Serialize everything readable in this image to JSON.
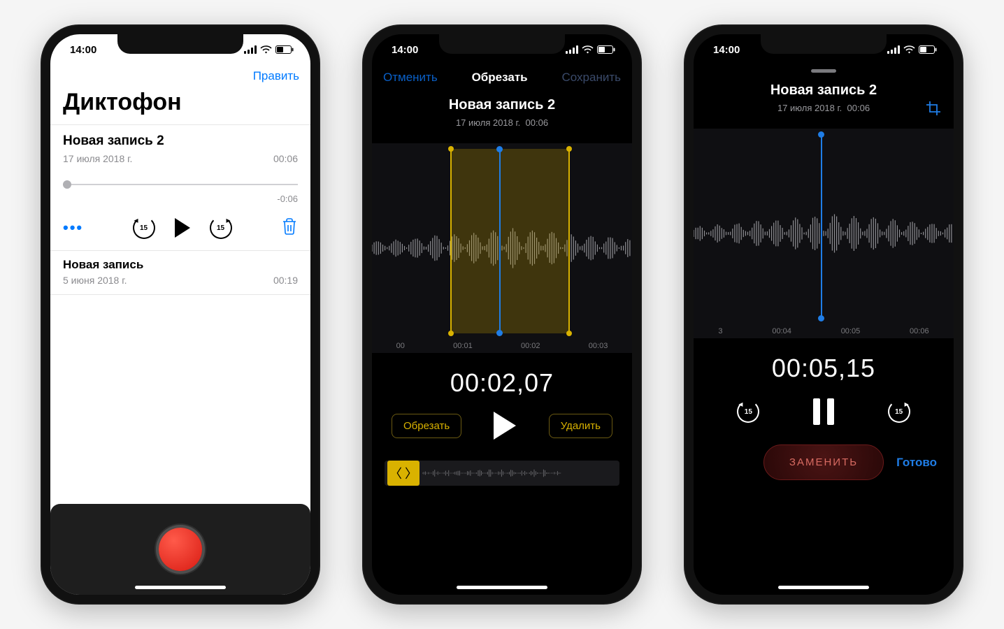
{
  "status": {
    "time": "14:00"
  },
  "screen1": {
    "edit": "Править",
    "appTitle": "Диктофон",
    "expanded": {
      "title": "Новая запись 2",
      "date": "17 июля 2018 г.",
      "duration": "00:06",
      "remaining": "-0:06"
    },
    "secondRow": {
      "title": "Новая запись",
      "date": "5 июня 2018 г.",
      "duration": "00:19"
    },
    "skipValue": "15"
  },
  "screen2": {
    "cancel": "Отменить",
    "navTitle": "Обрезать",
    "save": "Сохранить",
    "recTitle": "Новая запись 2",
    "recDate": "17 июля 2018 г.",
    "recDur": "00:06",
    "axis": [
      "00",
      "00:01",
      "00:02",
      "00:03"
    ],
    "time": "00:02,07",
    "trimBtn": "Обрезать",
    "deleteBtn": "Удалить"
  },
  "screen3": {
    "recTitle": "Новая запись 2",
    "recDate": "17 июля 2018 г.",
    "recDur": "00:06",
    "axis": [
      "3",
      "00:04",
      "00:05",
      "00:06"
    ],
    "time": "00:05,15",
    "skipValue": "15",
    "replace": "ЗАМЕНИТЬ",
    "done": "Готово"
  }
}
